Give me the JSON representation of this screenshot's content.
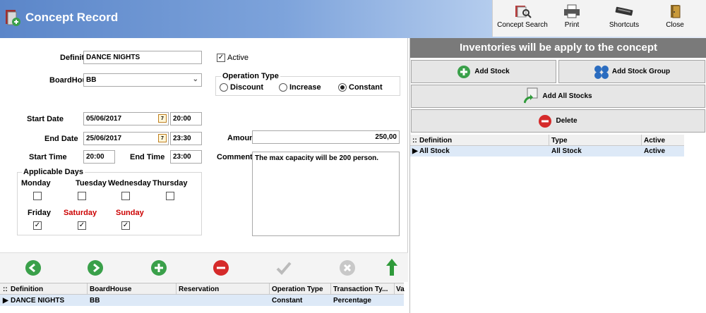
{
  "window": {
    "title": "Concept Record"
  },
  "toolbar": {
    "items": [
      {
        "label": "Concept Search",
        "icon": "concept-search-icon"
      },
      {
        "label": "Print",
        "icon": "printer-icon"
      },
      {
        "label": "Shortcuts",
        "icon": "shortcuts-icon"
      },
      {
        "label": "Close",
        "icon": "close-door-icon"
      }
    ]
  },
  "form": {
    "definition_label": "Definiti",
    "definition_value": "DANCE NIGHTS",
    "active_label": "Active",
    "active_checked": true,
    "boardhouse_label": "BoardHou",
    "boardhouse_value": "BB",
    "operation_type": {
      "legend": "Operation Type",
      "options": [
        "Discount",
        "Increase",
        "Constant"
      ],
      "selected": "Constant"
    },
    "start_date_label": "Start Date",
    "start_date": "05/06/2017",
    "start_date_time": "20:00",
    "end_date_label": "End Date",
    "end_date": "25/06/2017",
    "end_date_time": "23:30",
    "start_time_label": "Start Time",
    "start_time": "20:00",
    "end_time_label": "End Time",
    "end_time": "23:00",
    "amount_label": "Amoun",
    "amount_value": "250,00",
    "comment_label": "Comment",
    "comment_value": "The max capacity will be 200 person.",
    "calendar_icon_text": "7",
    "applicable_days": {
      "legend": "Applicable Days",
      "days": [
        {
          "name": "Monday",
          "checked": false,
          "weekend": false
        },
        {
          "name": "Tuesday",
          "checked": false,
          "weekend": false
        },
        {
          "name": "Wednesday",
          "checked": false,
          "weekend": false
        },
        {
          "name": "Thursday",
          "checked": false,
          "weekend": false
        },
        {
          "name": "Friday",
          "checked": true,
          "weekend": false
        },
        {
          "name": "Saturday",
          "checked": true,
          "weekend": true
        },
        {
          "name": "Sunday",
          "checked": true,
          "weekend": true
        }
      ]
    }
  },
  "nav": {
    "buttons": [
      "back-icon",
      "forward-icon",
      "add-icon",
      "remove-icon",
      "save-check-icon",
      "cancel-icon",
      "up-arrow-icon"
    ]
  },
  "bottom_grid": {
    "columns": [
      "Definition",
      "BoardHouse",
      "Reservation",
      "Operation Type",
      "Transaction Ty...",
      "Va"
    ],
    "rows": [
      [
        "DANCE NIGHTS",
        "BB",
        "",
        "Constant",
        "Percentage",
        ""
      ]
    ]
  },
  "inventory": {
    "header": "Inventories will be apply to the concept",
    "add_stock": "Add Stock",
    "add_stock_group": "Add Stock Group",
    "add_all_stocks": "Add All Stocks",
    "delete": "Delete",
    "columns": [
      "Definition",
      "Type",
      "Active"
    ],
    "rows": [
      [
        "All Stock",
        "All Stock",
        "Active"
      ]
    ]
  },
  "colors": {
    "weekend": "#cc0000",
    "accent": "#5b86c9",
    "selected_row": "#dde9f7"
  }
}
